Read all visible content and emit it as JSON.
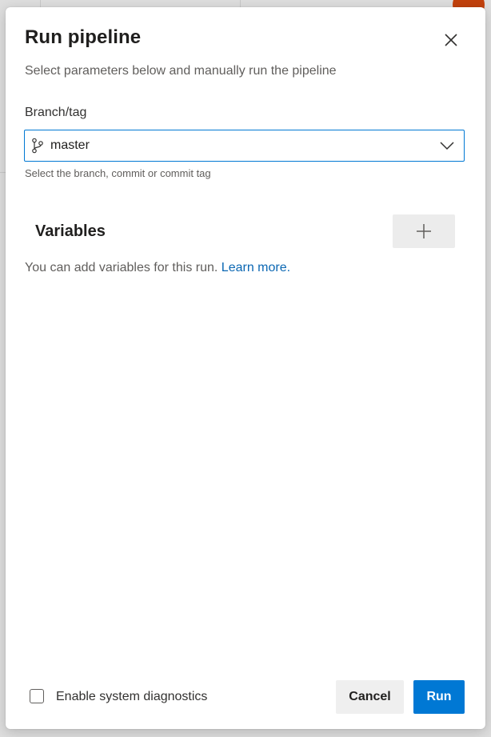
{
  "dialog": {
    "title": "Run pipeline",
    "subtitle": "Select parameters below and manually run the pipeline"
  },
  "branch_field": {
    "label": "Branch/tag",
    "value": "master",
    "helper": "Select the branch, commit or commit tag",
    "icon": "git-branch-icon"
  },
  "variables": {
    "title": "Variables",
    "info_text": "You can add variables for this run.",
    "link_text": "Learn more.",
    "add_icon": "plus-icon"
  },
  "footer": {
    "diagnostics_label": "Enable system diagnostics",
    "diagnostics_checked": false,
    "cancel_label": "Cancel",
    "run_label": "Run"
  },
  "colors": {
    "primary": "#0078d4",
    "link": "#0b67b3",
    "avatar": "#c2410c"
  }
}
